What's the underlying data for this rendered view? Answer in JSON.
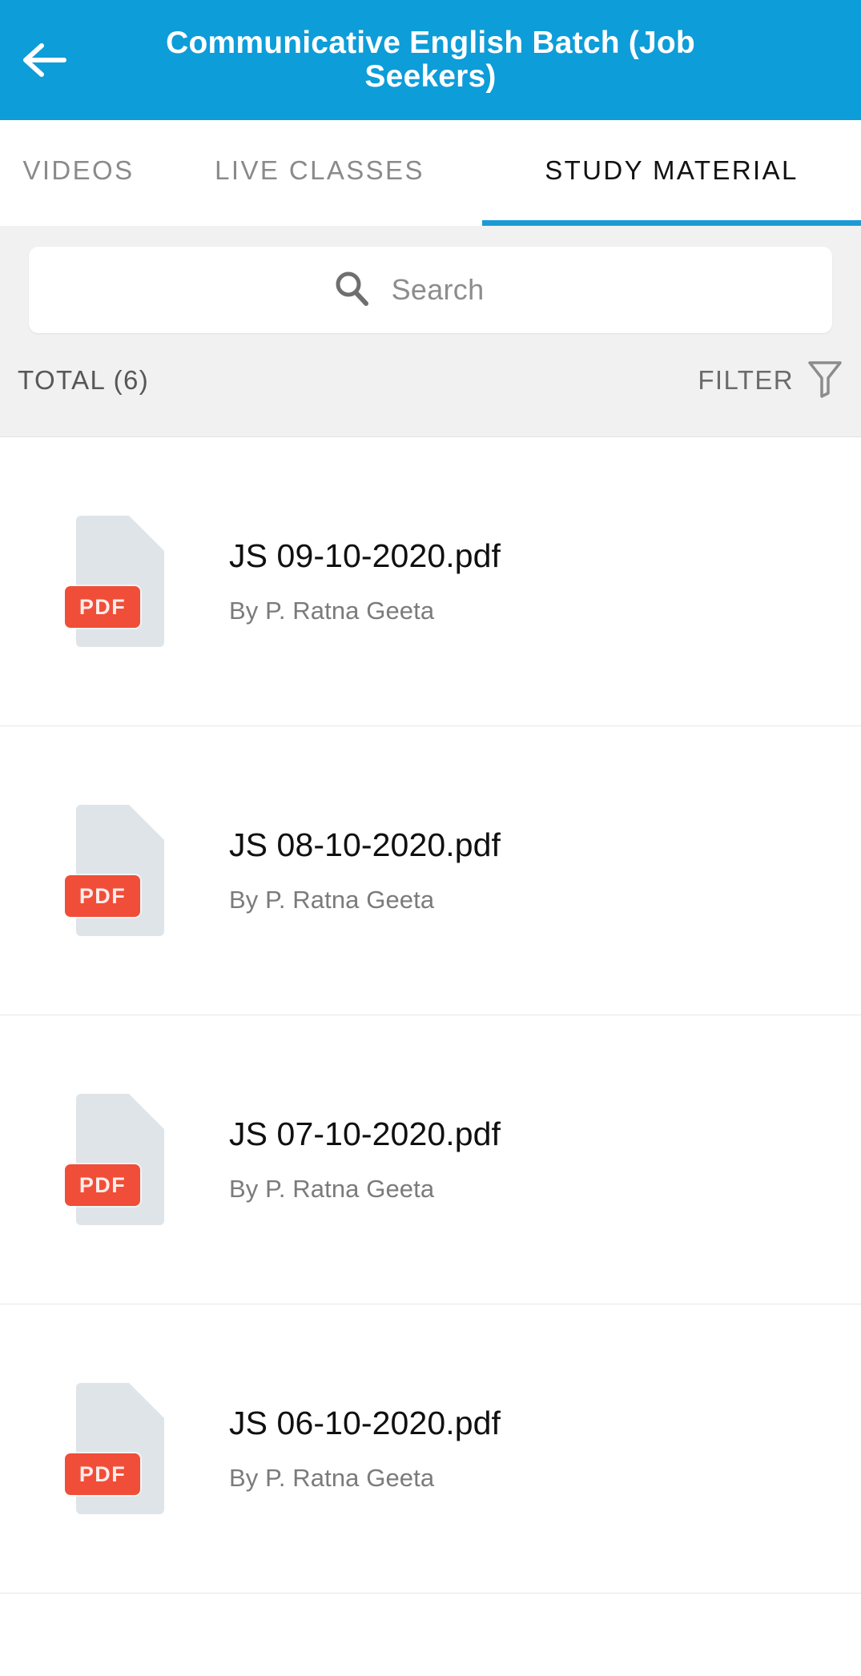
{
  "header": {
    "title": "Communicative English Batch  (Job\nSeekers)",
    "back_icon": "arrow-left-icon",
    "background_color": "#0d9dd8",
    "title_color": "#ffffff"
  },
  "tabs": {
    "active_index": 2,
    "active_underline_color": "#1b9ad6",
    "items": [
      {
        "label": "VIDEOS",
        "active": false
      },
      {
        "label": "LIVE CLASSES",
        "active": false
      },
      {
        "label": "STUDY MATERIAL",
        "active": true
      }
    ]
  },
  "search": {
    "placeholder": "Search",
    "value": "",
    "icon": "search-icon"
  },
  "meta": {
    "total_label": "TOTAL (6)",
    "total_count": 6,
    "filter_label": "FILTER",
    "filter_icon": "funnel-icon"
  },
  "list": {
    "icon_type": "pdf-file-icon",
    "badge_text": "PDF",
    "badge_color": "#f04e38",
    "page_color": "#dfe4e8",
    "items": [
      {
        "title": "JS 09-10-2020.pdf",
        "subtitle": "By P. Ratna Geeta"
      },
      {
        "title": "JS 08-10-2020.pdf",
        "subtitle": "By P. Ratna Geeta"
      },
      {
        "title": "JS 07-10-2020.pdf",
        "subtitle": "By P. Ratna Geeta"
      },
      {
        "title": "JS 06-10-2020.pdf",
        "subtitle": "By P. Ratna Geeta"
      }
    ]
  }
}
